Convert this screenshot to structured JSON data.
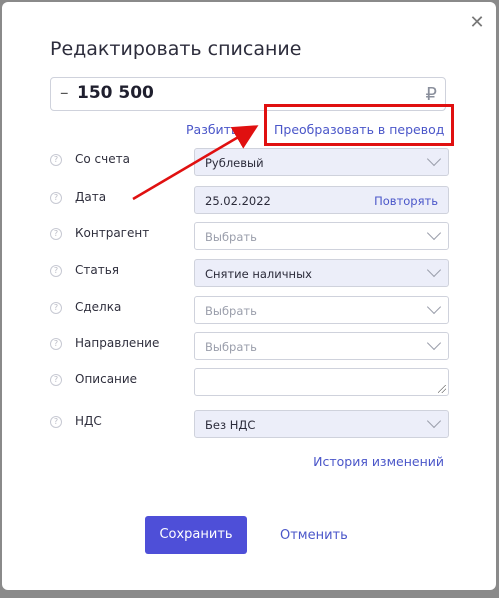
{
  "dialog": {
    "title": "Редактировать списание",
    "close_icon": "close-icon"
  },
  "amount": {
    "sign": "–",
    "value": "150 500",
    "currency": "₽"
  },
  "links": {
    "split": "Разбить",
    "convert": "Преобразовать в перевод",
    "history": "История изменений"
  },
  "fields": [
    {
      "label": "Со счета",
      "value": "Рублевый",
      "placeholder": false,
      "type": "select"
    },
    {
      "label": "Дата",
      "value": "25.02.2022",
      "placeholder": false,
      "type": "date",
      "action": "Повторять"
    },
    {
      "label": "Контрагент",
      "value": "Выбрать",
      "placeholder": true,
      "type": "select"
    },
    {
      "label": "Статья",
      "value": "Снятие наличных",
      "placeholder": false,
      "type": "select"
    },
    {
      "label": "Сделка",
      "value": "Выбрать",
      "placeholder": true,
      "type": "select"
    },
    {
      "label": "Направление",
      "value": "Выбрать",
      "placeholder": true,
      "type": "select"
    },
    {
      "label": "Описание",
      "value": "",
      "placeholder": true,
      "type": "textarea"
    },
    {
      "label": "НДС",
      "value": "Без НДС",
      "placeholder": false,
      "type": "select"
    }
  ],
  "buttons": {
    "save": "Сохранить",
    "cancel": "Отменить"
  },
  "colors": {
    "accent": "#4e4fd8",
    "link": "#4a56c9",
    "highlight": "#e01010",
    "filled_field": "#eceef9"
  }
}
